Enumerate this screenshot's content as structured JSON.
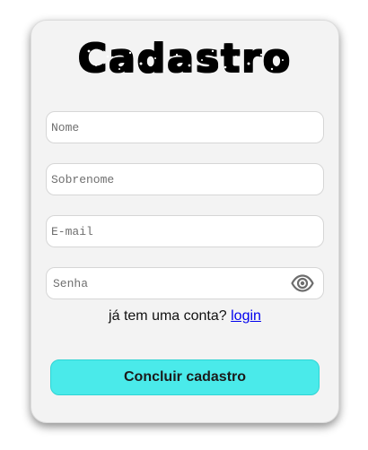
{
  "form": {
    "title": "Cadastro",
    "fields": {
      "nome": {
        "placeholder": "Nome",
        "value": ""
      },
      "sobrenome": {
        "placeholder": "Sobrenome",
        "value": ""
      },
      "email": {
        "placeholder": "E-mail",
        "value": ""
      },
      "senha": {
        "placeholder": "Senha",
        "value": ""
      }
    },
    "password_toggle_icon": "eye-icon",
    "login_prompt": "já tem uma conta?",
    "login_link": "login",
    "submit_label": "Concluir cadastro"
  },
  "colors": {
    "submit_background": "#4aeaea",
    "card_background": "#f3f3f3",
    "link": "#0000ee"
  }
}
